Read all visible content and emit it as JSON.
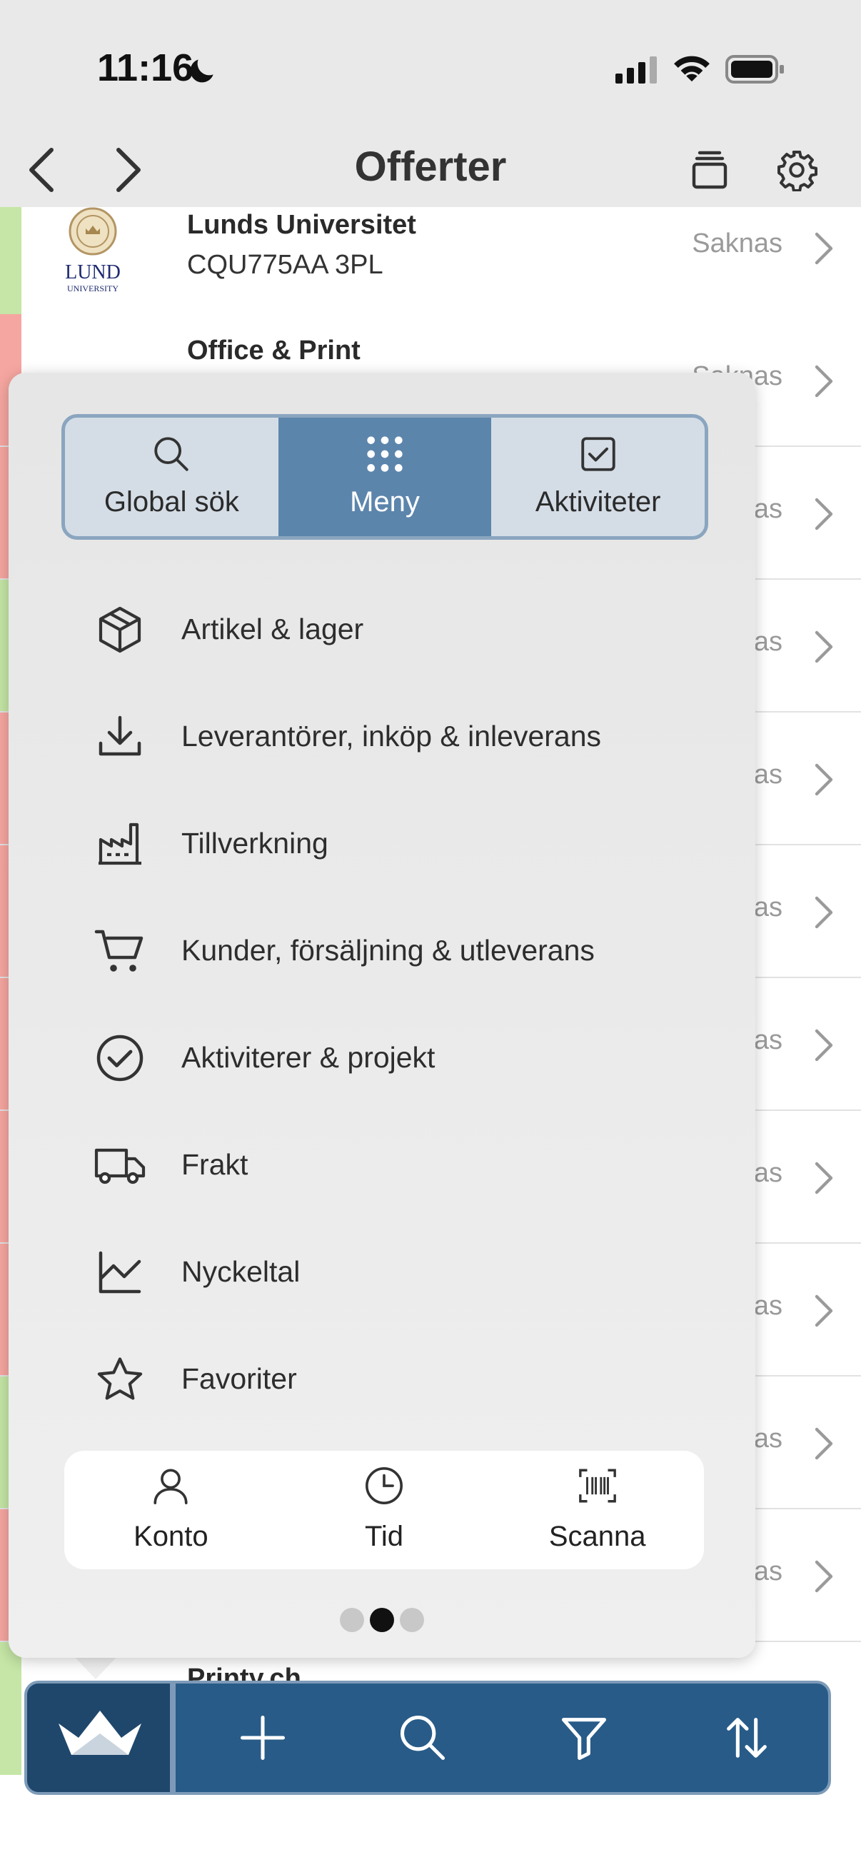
{
  "status_bar": {
    "time": "11:16"
  },
  "nav": {
    "title": "Offerter"
  },
  "list": {
    "rows": [
      {
        "name": "Lunds Universitet",
        "sub": "CQU775AA 3PL",
        "status": "Saknas",
        "stripe": "#c5e6a6",
        "logo_text": "LUND",
        "logo_sub": "UNIVERSITY"
      },
      {
        "name": "Office & Print",
        "sub": "",
        "status": "Saknas",
        "stripe": "#f6a6a0"
      },
      {
        "name": "",
        "sub": "",
        "status": "Saknas",
        "stripe": "#f6a6a0"
      },
      {
        "name": "",
        "sub": "",
        "status": "Saknas",
        "stripe": "#c5e6a6"
      },
      {
        "name": "",
        "sub": "",
        "status": "Saknas",
        "stripe": "#f6a6a0"
      },
      {
        "name": "",
        "sub": "",
        "status": "Saknas",
        "stripe": "#f6a6a0"
      },
      {
        "name": "",
        "sub": "",
        "status": "Saknas",
        "stripe": "#f6a6a0"
      },
      {
        "name": "",
        "sub": "",
        "status": "Saknas",
        "stripe": "#f6a6a0"
      },
      {
        "name": "",
        "sub": "",
        "status": "Saknas",
        "stripe": "#f6a6a0"
      },
      {
        "name": "",
        "sub": "",
        "status": "Saknas",
        "stripe": "#c5e6a6"
      },
      {
        "name": "",
        "sub": "",
        "status": "Saknas",
        "stripe": "#f6a6a0"
      },
      {
        "name": "Printy.ch",
        "sub": "",
        "status": "",
        "stripe": "#c5e6a6"
      }
    ]
  },
  "popup": {
    "tabs": [
      {
        "label": "Global sök",
        "icon": "search-icon",
        "active": false
      },
      {
        "label": "Meny",
        "icon": "grid-icon",
        "active": true
      },
      {
        "label": "Aktiviteter",
        "icon": "checkbox-icon",
        "active": false
      }
    ],
    "menu": [
      {
        "label": "Artikel & lager",
        "icon": "box-icon"
      },
      {
        "label": "Leverantörer, inköp & inleverans",
        "icon": "download-icon"
      },
      {
        "label": "Tillverkning",
        "icon": "factory-icon"
      },
      {
        "label": "Kunder, försäljning & utleverans",
        "icon": "cart-icon"
      },
      {
        "label": "Aktiviterer & projekt",
        "icon": "check-circle-icon"
      },
      {
        "label": "Frakt",
        "icon": "truck-icon"
      },
      {
        "label": "Nyckeltal",
        "icon": "line-chart-icon"
      },
      {
        "label": "Favoriter",
        "icon": "star-icon"
      }
    ],
    "quick": [
      {
        "label": "Konto",
        "icon": "person-icon"
      },
      {
        "label": "Tid",
        "icon": "clock-icon"
      },
      {
        "label": "Scanna",
        "icon": "barcode-icon"
      }
    ],
    "page_dots": {
      "count": 3,
      "active": 2
    }
  },
  "toolbar": {
    "buttons": [
      "home-crown-icon",
      "plus-icon",
      "search-icon",
      "filter-icon",
      "sort-icon"
    ]
  },
  "colors": {
    "accent": "#5c85ac",
    "toolbar": "#285b88",
    "toolbar_dark": "#1f476c",
    "stripe_green": "#c5e6a6",
    "stripe_red": "#f6a6a0"
  }
}
